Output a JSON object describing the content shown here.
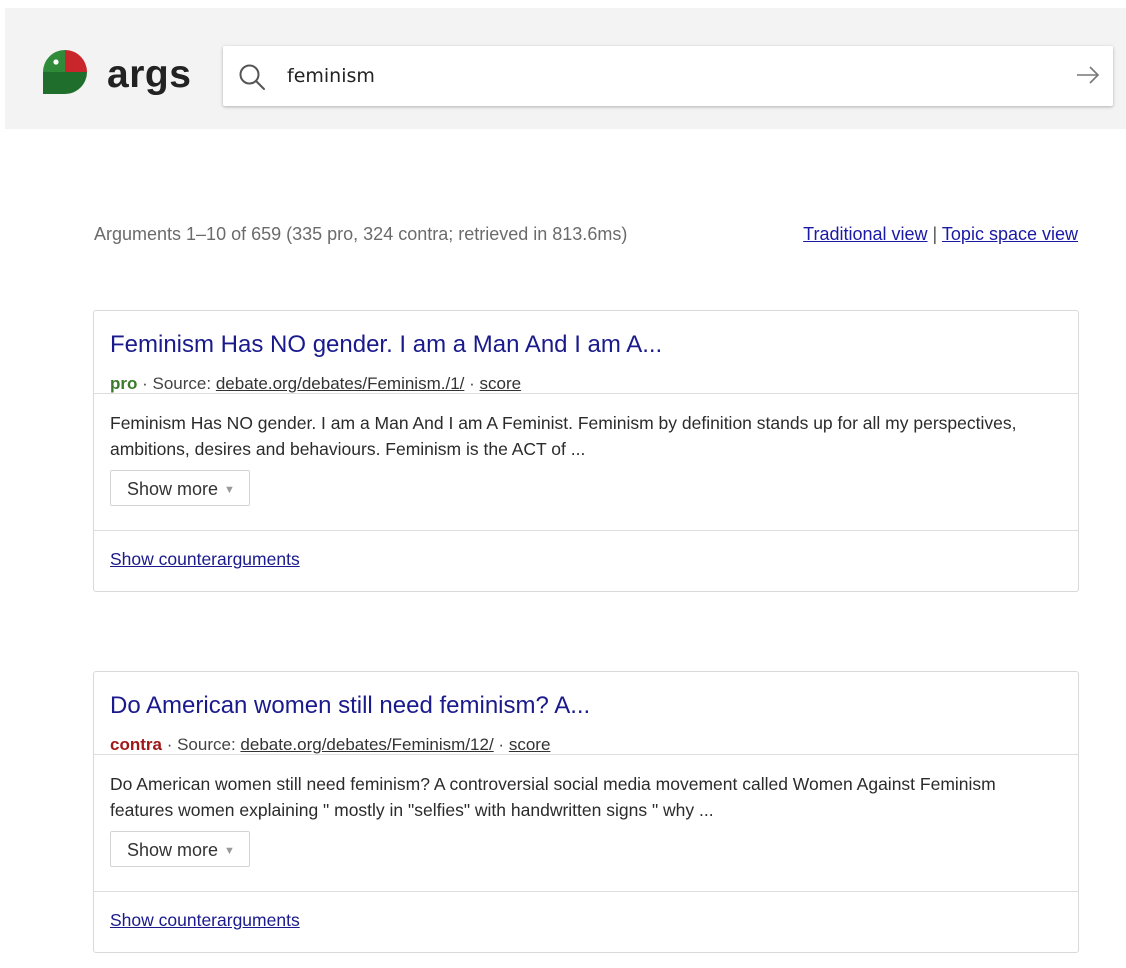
{
  "header": {
    "logo_text": "args",
    "search": {
      "value": "feminism",
      "placeholder": ""
    },
    "submit_icon": "arrow-right-icon",
    "search_icon": "search-icon",
    "colors": {
      "logo_red": "#c8262a",
      "logo_green": "#2f8a3a",
      "logo_dark_green": "#1f6e2c"
    }
  },
  "results": {
    "summary": "Arguments 1–10 of 659 (335 pro, 324 contra; retrieved in 813.6ms)",
    "traditional_view_label": "Traditional view",
    "separator": "|",
    "topic_space_view_label": "Topic space view"
  },
  "arguments": [
    {
      "title": "Feminism Has NO gender. I am a Man And I am A...",
      "stance": "pro",
      "source_label": "· Source:",
      "source": "debate.org/debates/Feminism./1/",
      "dot": "·",
      "score_label": "score",
      "text": "Feminism Has NO gender. I am a Man And I am A Feminist. Feminism by definition stands up for all my perspectives, ambitions, desires and behaviours. Feminism is the ACT of ...",
      "show_more_label": "Show more",
      "counterarguments_label": "Show counterarguments"
    },
    {
      "title": "Do American women still need feminism? A...",
      "stance": "contra",
      "source_label": "· Source:",
      "source": "debate.org/debates/Feminism/12/",
      "dot": "·",
      "score_label": "score",
      "text": "Do American women still need feminism? A controversial social media movement called Women Against Feminism features women explaining \" mostly in \"selfies\" with handwritten signs \" why ...",
      "show_more_label": "Show more",
      "counterarguments_label": "Show counterarguments"
    }
  ],
  "stance_colors": {
    "pro": "#3b7a2a",
    "contra": "#a01818"
  },
  "link_color": "#1a1a8c"
}
